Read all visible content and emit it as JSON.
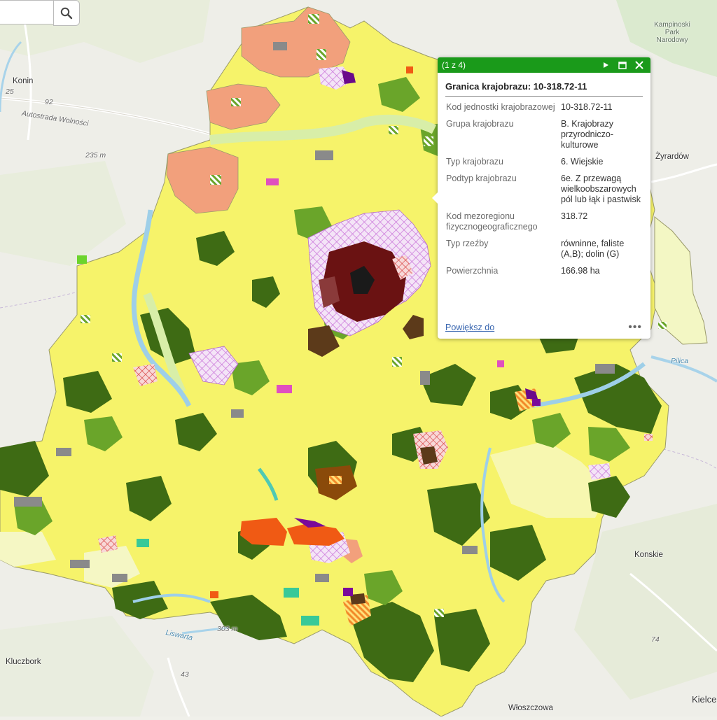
{
  "search": {
    "value": "",
    "placeholder": ""
  },
  "map_labels": {
    "konin": "Konin",
    "road_25": "25",
    "road_92": "92",
    "autostrada": "Autostrada Wolności",
    "elev_235": "235 m",
    "kampinoski": "Kampinoski Park Narodowy",
    "zyrardow": "Żyrardów",
    "pilica": "Pilica",
    "konskie": "Konskie",
    "road_74": "74",
    "kluczbork": "Kluczbork",
    "liswarta": "Liswarta",
    "elev_303": "303 m",
    "road_43": "43",
    "wloszczowa": "Włoszczowa",
    "kielce": "Kielce"
  },
  "popup": {
    "count": "(1 z 4)",
    "title": "Granica krajobrazu: 10-318.72-11",
    "rows": [
      {
        "key": "Kod jednostki krajobrazowej",
        "value": "10-318.72-11"
      },
      {
        "key": "Grupa krajobrazu",
        "value": "B. Krajobrazy przyrodniczo-kulturowe"
      },
      {
        "key": "Typ krajobrazu",
        "value": "6. Wiejskie"
      },
      {
        "key": "Podtyp krajobrazu",
        "value": "6e. Z przewagą wielkoobszarowych pól lub łąk i pastwisk"
      },
      {
        "key": "Kod mezoregionu fizycznogeograficznego",
        "value": "318.72"
      },
      {
        "key": "Typ rzeźby",
        "value": "równinne, faliste (A,B); dolin (G)"
      },
      {
        "key": "Powierzchnia",
        "value": "166.98 ha"
      }
    ],
    "zoom_label": "Powiększ do",
    "more_label": "•••"
  },
  "icons": {
    "search": "search-icon",
    "next": "play-icon",
    "maximize": "maximize-icon",
    "close": "close-icon"
  },
  "colors": {
    "header": "#1a9a1a",
    "link": "#3a67b0",
    "agri_yellow": "#f6f36a",
    "forest_dark": "#3e6b14",
    "forest_mid": "#6aa52a",
    "urban_hatch": "#e3a0ee",
    "urban_core": "#6a1212",
    "river": "#9ecfe8",
    "salmon": "#f2a07c"
  }
}
